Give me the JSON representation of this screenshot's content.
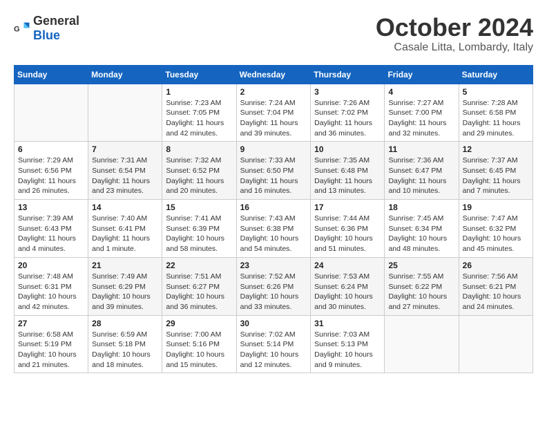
{
  "header": {
    "logo_general": "General",
    "logo_blue": "Blue",
    "month": "October 2024",
    "location": "Casale Litta, Lombardy, Italy"
  },
  "weekdays": [
    "Sunday",
    "Monday",
    "Tuesday",
    "Wednesday",
    "Thursday",
    "Friday",
    "Saturday"
  ],
  "weeks": [
    [
      {
        "day": "",
        "sunrise": "",
        "sunset": "",
        "daylight": ""
      },
      {
        "day": "",
        "sunrise": "",
        "sunset": "",
        "daylight": ""
      },
      {
        "day": "1",
        "sunrise": "Sunrise: 7:23 AM",
        "sunset": "Sunset: 7:05 PM",
        "daylight": "Daylight: 11 hours and 42 minutes."
      },
      {
        "day": "2",
        "sunrise": "Sunrise: 7:24 AM",
        "sunset": "Sunset: 7:04 PM",
        "daylight": "Daylight: 11 hours and 39 minutes."
      },
      {
        "day": "3",
        "sunrise": "Sunrise: 7:26 AM",
        "sunset": "Sunset: 7:02 PM",
        "daylight": "Daylight: 11 hours and 36 minutes."
      },
      {
        "day": "4",
        "sunrise": "Sunrise: 7:27 AM",
        "sunset": "Sunset: 7:00 PM",
        "daylight": "Daylight: 11 hours and 32 minutes."
      },
      {
        "day": "5",
        "sunrise": "Sunrise: 7:28 AM",
        "sunset": "Sunset: 6:58 PM",
        "daylight": "Daylight: 11 hours and 29 minutes."
      }
    ],
    [
      {
        "day": "6",
        "sunrise": "Sunrise: 7:29 AM",
        "sunset": "Sunset: 6:56 PM",
        "daylight": "Daylight: 11 hours and 26 minutes."
      },
      {
        "day": "7",
        "sunrise": "Sunrise: 7:31 AM",
        "sunset": "Sunset: 6:54 PM",
        "daylight": "Daylight: 11 hours and 23 minutes."
      },
      {
        "day": "8",
        "sunrise": "Sunrise: 7:32 AM",
        "sunset": "Sunset: 6:52 PM",
        "daylight": "Daylight: 11 hours and 20 minutes."
      },
      {
        "day": "9",
        "sunrise": "Sunrise: 7:33 AM",
        "sunset": "Sunset: 6:50 PM",
        "daylight": "Daylight: 11 hours and 16 minutes."
      },
      {
        "day": "10",
        "sunrise": "Sunrise: 7:35 AM",
        "sunset": "Sunset: 6:48 PM",
        "daylight": "Daylight: 11 hours and 13 minutes."
      },
      {
        "day": "11",
        "sunrise": "Sunrise: 7:36 AM",
        "sunset": "Sunset: 6:47 PM",
        "daylight": "Daylight: 11 hours and 10 minutes."
      },
      {
        "day": "12",
        "sunrise": "Sunrise: 7:37 AM",
        "sunset": "Sunset: 6:45 PM",
        "daylight": "Daylight: 11 hours and 7 minutes."
      }
    ],
    [
      {
        "day": "13",
        "sunrise": "Sunrise: 7:39 AM",
        "sunset": "Sunset: 6:43 PM",
        "daylight": "Daylight: 11 hours and 4 minutes."
      },
      {
        "day": "14",
        "sunrise": "Sunrise: 7:40 AM",
        "sunset": "Sunset: 6:41 PM",
        "daylight": "Daylight: 11 hours and 1 minute."
      },
      {
        "day": "15",
        "sunrise": "Sunrise: 7:41 AM",
        "sunset": "Sunset: 6:39 PM",
        "daylight": "Daylight: 10 hours and 58 minutes."
      },
      {
        "day": "16",
        "sunrise": "Sunrise: 7:43 AM",
        "sunset": "Sunset: 6:38 PM",
        "daylight": "Daylight: 10 hours and 54 minutes."
      },
      {
        "day": "17",
        "sunrise": "Sunrise: 7:44 AM",
        "sunset": "Sunset: 6:36 PM",
        "daylight": "Daylight: 10 hours and 51 minutes."
      },
      {
        "day": "18",
        "sunrise": "Sunrise: 7:45 AM",
        "sunset": "Sunset: 6:34 PM",
        "daylight": "Daylight: 10 hours and 48 minutes."
      },
      {
        "day": "19",
        "sunrise": "Sunrise: 7:47 AM",
        "sunset": "Sunset: 6:32 PM",
        "daylight": "Daylight: 10 hours and 45 minutes."
      }
    ],
    [
      {
        "day": "20",
        "sunrise": "Sunrise: 7:48 AM",
        "sunset": "Sunset: 6:31 PM",
        "daylight": "Daylight: 10 hours and 42 minutes."
      },
      {
        "day": "21",
        "sunrise": "Sunrise: 7:49 AM",
        "sunset": "Sunset: 6:29 PM",
        "daylight": "Daylight: 10 hours and 39 minutes."
      },
      {
        "day": "22",
        "sunrise": "Sunrise: 7:51 AM",
        "sunset": "Sunset: 6:27 PM",
        "daylight": "Daylight: 10 hours and 36 minutes."
      },
      {
        "day": "23",
        "sunrise": "Sunrise: 7:52 AM",
        "sunset": "Sunset: 6:26 PM",
        "daylight": "Daylight: 10 hours and 33 minutes."
      },
      {
        "day": "24",
        "sunrise": "Sunrise: 7:53 AM",
        "sunset": "Sunset: 6:24 PM",
        "daylight": "Daylight: 10 hours and 30 minutes."
      },
      {
        "day": "25",
        "sunrise": "Sunrise: 7:55 AM",
        "sunset": "Sunset: 6:22 PM",
        "daylight": "Daylight: 10 hours and 27 minutes."
      },
      {
        "day": "26",
        "sunrise": "Sunrise: 7:56 AM",
        "sunset": "Sunset: 6:21 PM",
        "daylight": "Daylight: 10 hours and 24 minutes."
      }
    ],
    [
      {
        "day": "27",
        "sunrise": "Sunrise: 6:58 AM",
        "sunset": "Sunset: 5:19 PM",
        "daylight": "Daylight: 10 hours and 21 minutes."
      },
      {
        "day": "28",
        "sunrise": "Sunrise: 6:59 AM",
        "sunset": "Sunset: 5:18 PM",
        "daylight": "Daylight: 10 hours and 18 minutes."
      },
      {
        "day": "29",
        "sunrise": "Sunrise: 7:00 AM",
        "sunset": "Sunset: 5:16 PM",
        "daylight": "Daylight: 10 hours and 15 minutes."
      },
      {
        "day": "30",
        "sunrise": "Sunrise: 7:02 AM",
        "sunset": "Sunset: 5:14 PM",
        "daylight": "Daylight: 10 hours and 12 minutes."
      },
      {
        "day": "31",
        "sunrise": "Sunrise: 7:03 AM",
        "sunset": "Sunset: 5:13 PM",
        "daylight": "Daylight: 10 hours and 9 minutes."
      },
      {
        "day": "",
        "sunrise": "",
        "sunset": "",
        "daylight": ""
      },
      {
        "day": "",
        "sunrise": "",
        "sunset": "",
        "daylight": ""
      }
    ]
  ]
}
